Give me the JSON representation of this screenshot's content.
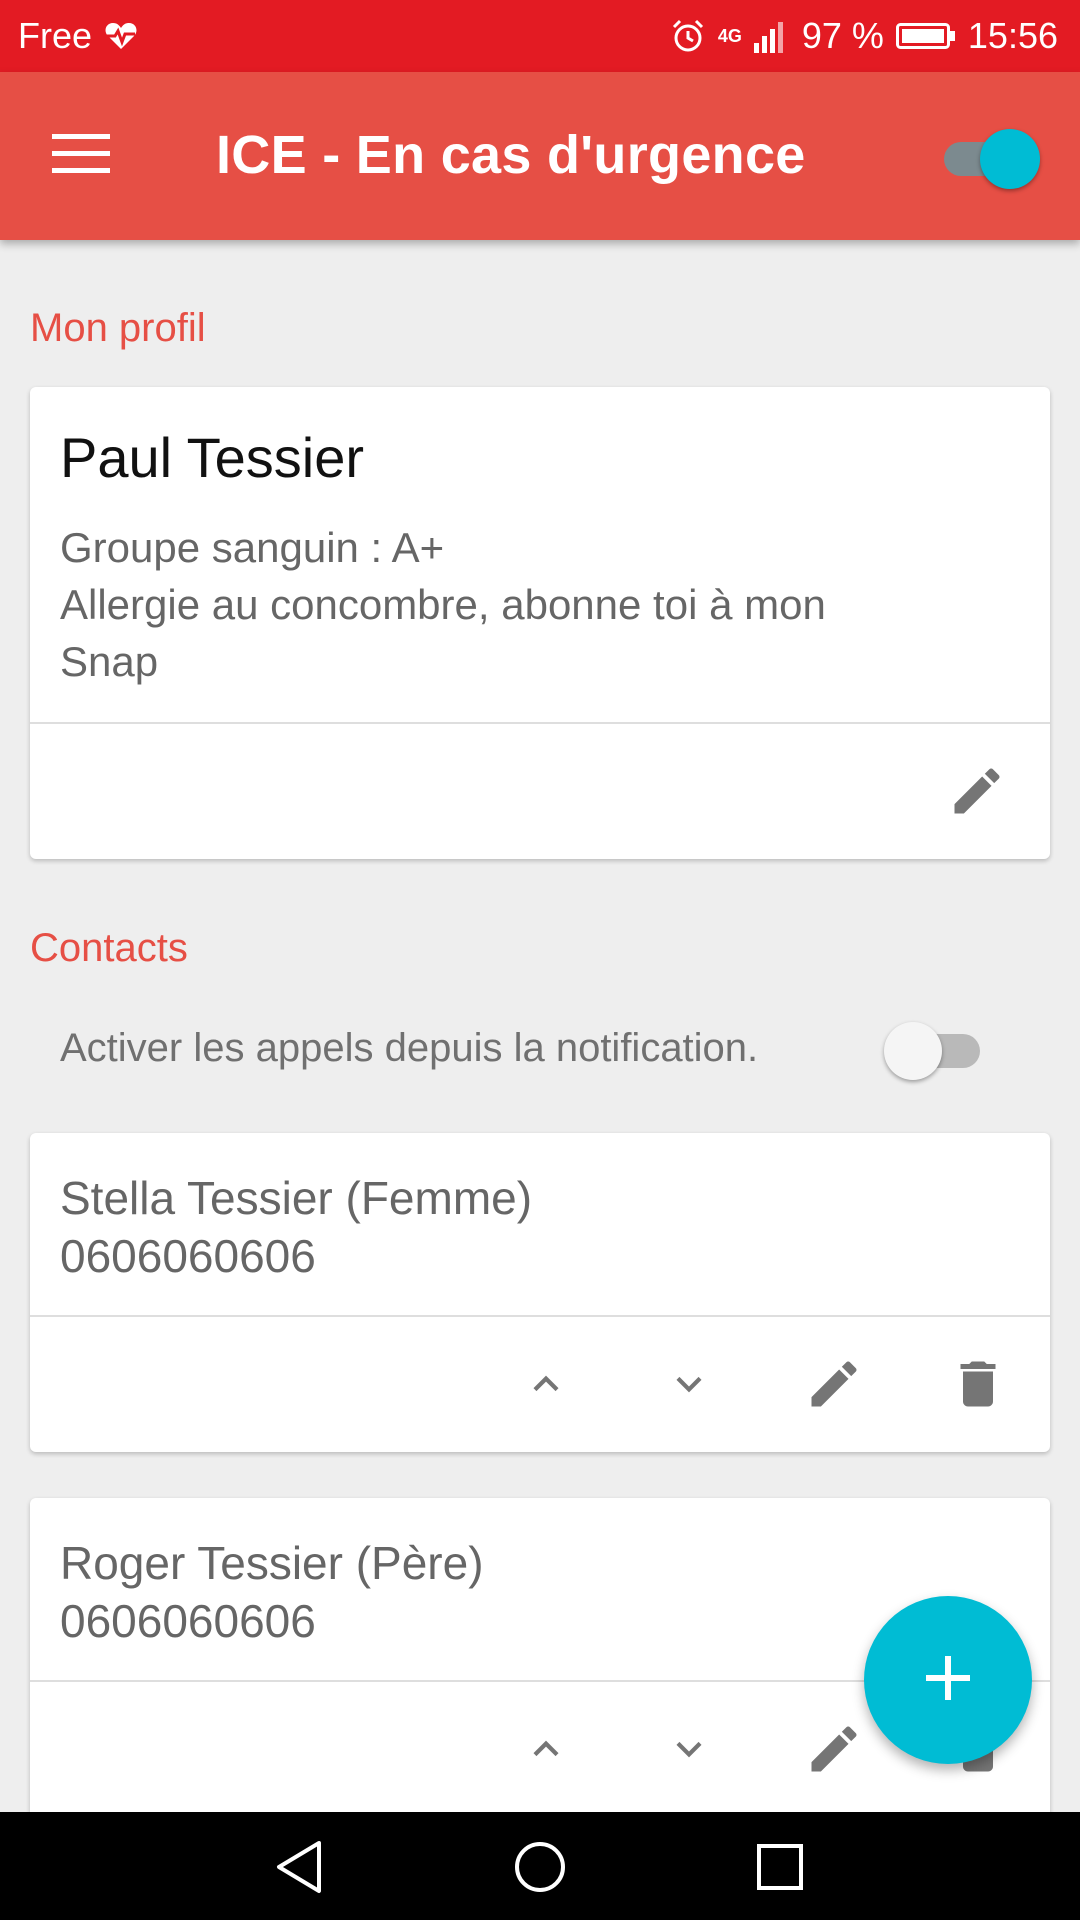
{
  "status_bar": {
    "carrier": "Free",
    "network": "4G",
    "battery_percent": "97 %",
    "time": "15:56",
    "icons": [
      "heart-pulse-icon",
      "alarm-icon",
      "signal-icon",
      "battery-icon"
    ]
  },
  "app_bar": {
    "title": "ICE - En cas d'urgence",
    "menu_icon": "hamburger-menu-icon",
    "master_toggle_on": true
  },
  "profile": {
    "section_title": "Mon profil",
    "name": "Paul Tessier",
    "details_line1": "Groupe sanguin : A+",
    "details_line2": "Allergie au concombre, abonne toi à mon",
    "details_line3": "Snap",
    "edit_icon": "pencil-icon"
  },
  "contacts": {
    "section_title": "Contacts",
    "notification_toggle_label": "Activer les appels depuis la notification.",
    "notification_toggle_on": false,
    "items": [
      {
        "name": "Stella Tessier  (Femme)",
        "phone": "0606060606"
      },
      {
        "name": "Roger Tessier  (Père)",
        "phone": "0606060606"
      }
    ],
    "action_icons": [
      "chevron-up-icon",
      "chevron-down-icon",
      "pencil-icon",
      "trash-icon"
    ]
  },
  "fab": {
    "icon": "plus-icon"
  },
  "nav_bar": {
    "icons": [
      "back-icon",
      "home-icon",
      "recents-icon"
    ]
  },
  "colors": {
    "status_bar": "#e31b23",
    "app_bar": "#e64f45",
    "accent": "#00bcd4",
    "section_header": "#e64f45",
    "icon_gray": "#757575"
  }
}
